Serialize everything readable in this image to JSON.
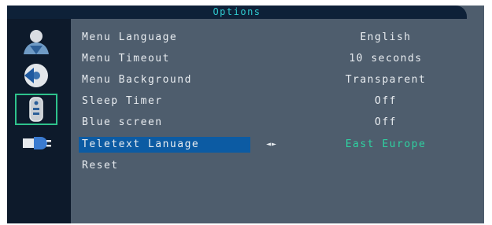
{
  "osd": {
    "title": "Options",
    "sidebar": {
      "icons": [
        {
          "name": "user-profile-icon",
          "selected": false
        },
        {
          "name": "disc-sound-icon",
          "selected": false
        },
        {
          "name": "remote-control-icon",
          "selected": true
        },
        {
          "name": "power-plug-icon",
          "selected": false
        }
      ]
    },
    "menu": {
      "items": [
        {
          "label": "Menu Language",
          "value": "English"
        },
        {
          "label": "Menu Timeout",
          "value": "10 seconds"
        },
        {
          "label": "Menu Background",
          "value": "Transparent"
        },
        {
          "label": "Sleep Timer",
          "value": "Off"
        },
        {
          "label": "Blue screen",
          "value": "Off"
        },
        {
          "label": "Teletext Lanuage",
          "value": "East Europe",
          "selected": true,
          "arrows": "◄►"
        },
        {
          "label": "Reset",
          "value": ""
        }
      ]
    },
    "colors": {
      "panel": "#4e5d6d",
      "titlebar": "#0e2138",
      "sidebar": "#0d1a2b",
      "title_text": "#2fcbd0",
      "highlight": "#0c5ba3",
      "selected_value": "#2fd0a0",
      "icon_frame": "#2ec28c"
    }
  }
}
